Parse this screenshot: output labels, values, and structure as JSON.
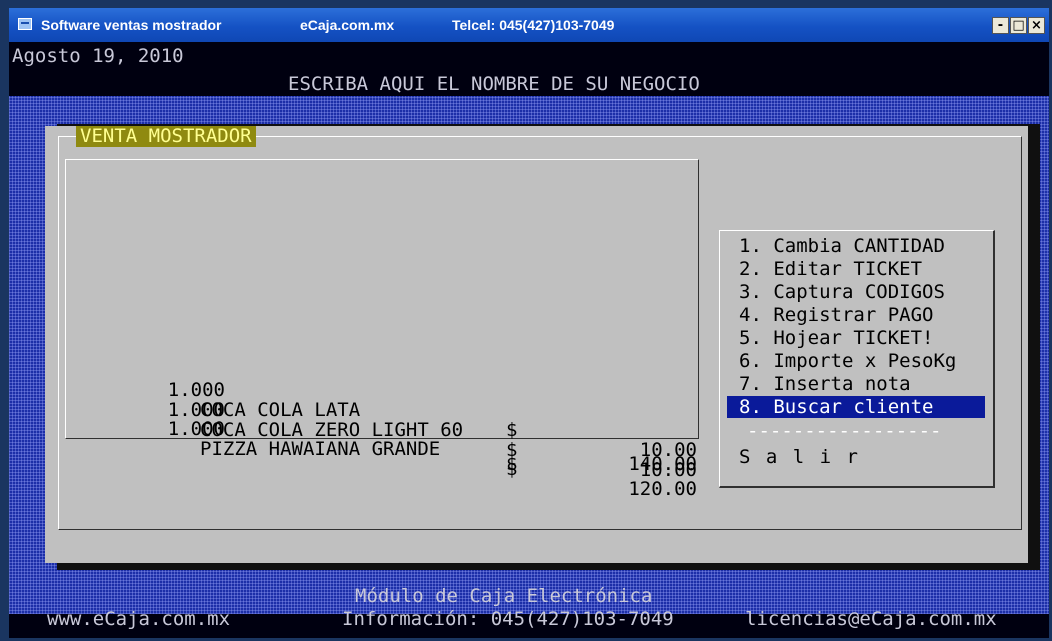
{
  "titlebar": {
    "app_name": "Software ventas mostrador",
    "site": "eCaja.com.mx",
    "phone": "Telcel: 045(427)103-7049",
    "btn_minimize": "-",
    "btn_maximize": "□",
    "btn_close": "×"
  },
  "header": {
    "date": "Agosto 19, 2010",
    "business_name": "ESCRIBA AQUI EL NOMBRE DE SU NEGOCIO"
  },
  "panel": {
    "title": "VENTA MOSTRADOR"
  },
  "ticket": {
    "items": [
      {
        "qty": "1.000",
        "desc": "COCA COLA LATA",
        "currency": "$",
        "amount": "10.00"
      },
      {
        "qty": "1.000",
        "desc": "COCA COLA ZERO LIGHT 60",
        "currency": "$",
        "amount": "10.00"
      },
      {
        "qty": "1.000",
        "desc": "PIZZA HAWAIANA GRANDE",
        "currency": "$",
        "amount": "120.00"
      }
    ],
    "total_currency": "$",
    "total": "140.00"
  },
  "menu": {
    "items": [
      "1. Cambia CANTIDAD",
      "2. Editar TICKET",
      "3. Captura CODIGOS",
      "4. Registrar PAGO",
      "5. Hojear TICKET!",
      "6. Importe x PesoKg",
      "7. Inserta nota",
      "8. Buscar cliente"
    ],
    "selected_index": 7,
    "separator": "-----------------",
    "exit": "S a l i r"
  },
  "footer": {
    "module": "Módulo de Caja Electrónica",
    "website": "www.eCaja.com.mx",
    "info": "Información: 045(427)103-7049",
    "email": "licencias@eCaja.com.mx"
  },
  "colors": {
    "titlebar": "#1552c4",
    "console_bg": "#000010",
    "panel_bg": "#c0c0c0",
    "title_badge": "#8f8a10",
    "selection": "#0a1a9a"
  }
}
